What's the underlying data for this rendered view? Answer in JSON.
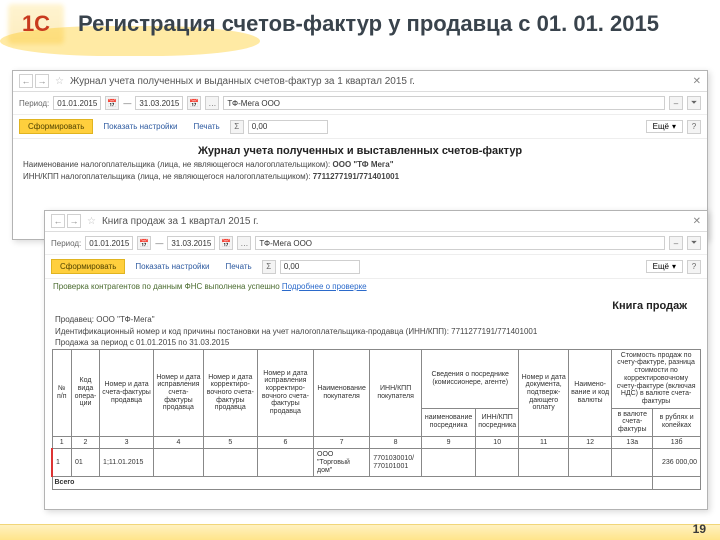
{
  "header": {
    "logo": "1C",
    "title": "Регистрация счетов-фактур у продавца с 01. 01. 2015"
  },
  "window1": {
    "title": "Журнал учета полученных и выданных счетов-фактур за 1 квартал 2015 г.",
    "periodLabel": "Период:",
    "date_from": "01.01.2015",
    "date_to": "31.03.2015",
    "org": "ТФ-Мега ООО",
    "btnForm": "Сформировать",
    "btnSettings": "Показать настройки",
    "btnPrint": "Печать",
    "sigma": "Σ",
    "sum": "0,00",
    "more": "Ещё",
    "docTitle": "Журнал учета полученных и выставленных счетов-фактур",
    "line1a": "Наименование налогоплательщика (лица, не являющегося налогоплательщиком): ",
    "line1b": "ООО \"ТФ Мега\"",
    "line2a": "ИНН/КПП налогоплательщика (лица, не являющегося налогоплательщиком): ",
    "line2b": "7711277191/771401001"
  },
  "window2": {
    "title": "Книга продаж за 1 квартал 2015 г.",
    "periodLabel": "Период:",
    "date_from": "01.01.2015",
    "date_to": "31.03.2015",
    "org": "ТФ-Мега ООО",
    "btnForm": "Сформировать",
    "btnSettings": "Показать настройки",
    "btnPrint": "Печать",
    "sigma": "Σ",
    "sum": "0,00",
    "more": "Ещё",
    "checkLine": "Проверка контрагентов по данным ФНС выполнена успешно ",
    "checkLink": "Подробнее о проверке",
    "docTitle": "Книга продаж",
    "meta1": "Продавец: ООО \"ТФ-Мега\"",
    "meta2": "Идентификационный номер и код причины постановки на учет налогоплательщика-продавца (ИНН/КПП): 7711277191/771401001",
    "meta3": "Продажа за период с 01.01.2015 по 31.03.2015",
    "cols": {
      "c1": "№ п/п",
      "c2": "Код вида опера- ции",
      "c3": "Номер и дата счета-фактуры продавца",
      "c4": "Номер и дата исправления счета-фактуры продавца",
      "c5": "Номер и дата корректиро- вочного счета-фактуры продавца",
      "c6": "Номер и дата исправления корректиро- вочного счета-фактуры продавца",
      "c7": "Наименование покупателя",
      "c8": "ИНН/КПП покупателя",
      "c9": "Сведения о посреднике (комиссионере, агенте)",
      "c9a": "наименование посредника",
      "c9b": "ИНН/КПП посредника",
      "c10": "Номер и дата документа, подтверж- дающего оплату",
      "c11": "Наимено- вание и код валюты",
      "c12": "Стоимость продаж по счету-фактуре, разница стоимости по корректировочному счету-фактуре (включая НДС) в валюте счета-фактуры",
      "c12a": "в валюте счета-фактуры",
      "c12b": "в рублях и копейках"
    },
    "nums": [
      "1",
      "2",
      "3",
      "4",
      "5",
      "6",
      "7",
      "8",
      "9",
      "10",
      "11",
      "12",
      "13а",
      "13б"
    ],
    "row": {
      "n": "1",
      "op": "01",
      "sf": "1;11.01.2015",
      "buyer": "ООО \"Торговый дом\"",
      "inn": "7701030010/ 770101001",
      "sum": "236 000,00"
    },
    "totalLabel": "Всего"
  },
  "pageNum": "19"
}
